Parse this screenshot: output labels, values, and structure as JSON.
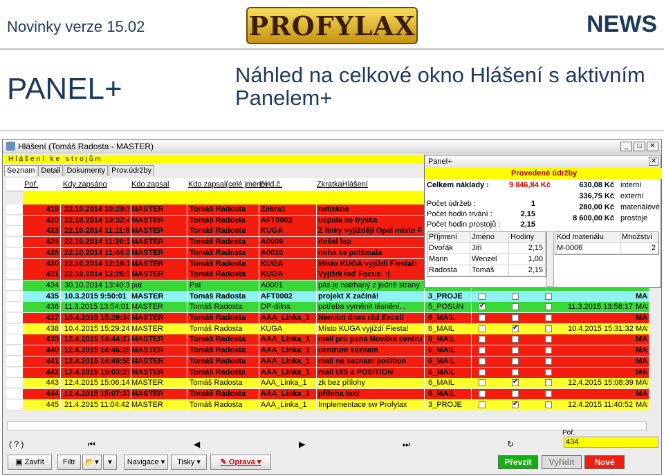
{
  "header": {
    "left": "Novinky verze 15.02",
    "logo": "PROFYLAX",
    "right": "NEWS"
  },
  "slide": {
    "title": "PANEL+",
    "subtitle": "Náhled na celkové okno Hlášení s aktivním Panelem+"
  },
  "window": {
    "title": "Hlášení (Tomáš Radosta - MASTER)",
    "subheader": "Hlášení ke strojům",
    "tabs": [
      "Seznam",
      "Detail",
      "Dokumenty",
      "Prov.údržby"
    ],
    "columns": [
      "Poř.",
      "Kdy zapsáno",
      "Kdo zapsal",
      "Kdo zapsal(celé jméno)",
      "Evid.č.",
      "ZkratkaHlášení"
    ],
    "rows": [
      {
        "n": "419",
        "d": "22.10.2014 10:29:3",
        "u": "MASTER",
        "f": "Tomáš Radosta",
        "e": "Zebra1",
        "z": "netiskne",
        "c3": "",
        "bg": "#f21c0f",
        "bold": true
      },
      {
        "n": "420",
        "d": "22.10.2014 10:32:4",
        "u": "MASTER",
        "f": "Tomáš Radosta",
        "e": "AFT0002",
        "z": "ucpala se tryska",
        "c3": "",
        "bg": "#f21c0f",
        "bold": true
      },
      {
        "n": "423",
        "d": "22.10.2014 11:11:5",
        "u": "MASTER",
        "f": "Tomáš Radosta",
        "e": "KUGA",
        "z": "Z linky vyjíždějí Opel místo F",
        "c3": "",
        "bg": "#f21c0f",
        "bold": true
      },
      {
        "n": "426",
        "d": "22.10.2014 11:20:1",
        "u": "MASTER",
        "f": "Tomáš Radosta",
        "e": "A0009",
        "z": "došel lep",
        "c3": "",
        "bg": "#f21c0f",
        "bold": true
      },
      {
        "n": "428",
        "d": "22.10.2014 11:44:2",
        "u": "MASTER",
        "f": "Tomáš Radosta",
        "e": "A0010",
        "z": "noha se polámala",
        "c3": "",
        "bg": "#f21c0f",
        "bold": true
      },
      {
        "n": "430",
        "d": "22.10.2014 12:16:1",
        "u": "MASTER",
        "f": "Tomáš Radosta",
        "e": "KUGA",
        "z": "Místo KUGA vyjíždí Fiesta!!",
        "c3": "",
        "bg": "#f21c0f",
        "bold": true
      },
      {
        "n": "431",
        "d": "22.10.2014 12:26:3",
        "u": "MASTER",
        "f": "Tomáš Radosta",
        "e": "KUGA",
        "z": "Vyjíždí teď Focus. :(",
        "c3": "",
        "bg": "#f21c0f",
        "bold": true
      },
      {
        "n": "434",
        "d": "30.10.2014 13:40:30",
        "u": "pat",
        "f": "Pat",
        "e": "A0001",
        "z": "pás je natrhaný z jedné strany",
        "c3": "",
        "bg": "#38d838",
        "bold": false
      },
      {
        "n": "435",
        "d": "10.3.2015 9:50:01",
        "u": "MASTER",
        "f": "Tomáš Radosta",
        "e": "AFT0002",
        "z": "projekt X začíná!",
        "c3": "3_PROJE",
        "bg": "#8ff2f2",
        "bold": true,
        "chk": [
          0,
          0,
          0
        ],
        "dt": ""
      },
      {
        "n": "436",
        "d": "11.3.2015 13:54:01",
        "u": "MASTER",
        "f": "Tomáš Radosta",
        "e": "DP-dílna",
        "z": "potřeba vyměnit těsnění...",
        "c3": "5_POSUN",
        "bg": "#38d838",
        "bold": false,
        "chk": [
          1,
          0,
          0
        ],
        "dt": "11.3.2015 13:58:17"
      },
      {
        "n": "437",
        "d": "10.4.2015 15:29:34",
        "u": "MASTER",
        "f": "Tomáš Radosta",
        "e": "AAA_Linka_1",
        "z": "Nemám dnes rád Excel!",
        "c3": "6_MAIL",
        "bg": "#f21c0f",
        "bold": true,
        "chk": [
          0,
          0,
          0
        ],
        "dt": ""
      },
      {
        "n": "438",
        "d": "10.4.2015 15:29:24",
        "u": "MASTER",
        "f": "Tomáš Radosta",
        "e": "KUGA",
        "z": "Místo KUGA vyjíždí Fiesta!",
        "c3": "6_MAIL",
        "bg": "#ffff2a",
        "bold": false,
        "chk": [
          0,
          1,
          0
        ],
        "dt": "10.4.2015 15:31:32"
      },
      {
        "n": "439",
        "d": "12.4.2015 14:44:27",
        "u": "MASTER",
        "f": "Tomáš Radosta",
        "e": "AAA_Linka_1",
        "z": "mail pro pana Nováka centrum",
        "c3": "6_MAIL",
        "bg": "#f21c0f",
        "bold": true,
        "chk": [
          0,
          0,
          0
        ],
        "dt": ""
      },
      {
        "n": "440",
        "d": "12.4.2015 14:46:28",
        "u": "MASTER",
        "f": "Tomáš Radosta",
        "e": "AAA_Linka_1",
        "z": "centrum seznam",
        "c3": "6_MAIL",
        "bg": "#f21c0f",
        "bold": true,
        "chk": [
          0,
          0,
          0
        ],
        "dt": ""
      },
      {
        "n": "441",
        "d": "12.4.2015 14:48:55",
        "u": "MASTER",
        "f": "Tomáš Radosta",
        "e": "AAA_Linka_1",
        "z": "mail na seznam position",
        "c3": "6_MAIL",
        "bg": "#f21c0f",
        "bold": true,
        "chk": [
          0,
          0,
          0
        ],
        "dt": ""
      },
      {
        "n": "442",
        "d": "12.4.2015 15:03:23",
        "u": "MASTER",
        "f": "Tomáš Radosta",
        "e": "AAA_Linka_1",
        "z": "mail UIS a POSITION",
        "c3": "6_MAIL",
        "bg": "#f21c0f",
        "bold": true,
        "chk": [
          0,
          0,
          0
        ],
        "dt": ""
      },
      {
        "n": "443",
        "d": "12.4.2015 15:06:14",
        "u": "MASTER",
        "f": "Tomáš Radosta",
        "e": "AAA_Linka_1",
        "z": "zk bez přílohy",
        "c3": "6_MAIL",
        "bg": "#ffff2a",
        "bold": false,
        "chk": [
          0,
          1,
          0
        ],
        "dt": "12.4.2015 15:08:39"
      },
      {
        "n": "444",
        "d": "12.4.2015 15:07:37",
        "u": "MASTER",
        "f": "Tomáš Radosta",
        "e": "AAA_Linka_1",
        "z": "příloha text",
        "c3": "6_MAIL",
        "bg": "#f21c0f",
        "bold": true,
        "chk": [
          0,
          0,
          0
        ],
        "dt": ""
      },
      {
        "n": "445",
        "d": "21.4.2015 11:04:42",
        "u": "MASTER",
        "f": "Tomáš Radosta",
        "e": "AAA_Linka_1",
        "z": "Implementace sw Profylax",
        "c3": "3_PROJE",
        "bg": "#ffff2a",
        "bold": false,
        "chk": [
          0,
          1,
          0
        ],
        "dt": "12.4.2015 11:40:52"
      }
    ],
    "extra_col": "MAS",
    "nav": {
      "help": "( ? )",
      "first": "⏮",
      "prev": "◀",
      "next": "▶",
      "last": "⏭",
      "refresh": "↻"
    },
    "por": {
      "label": "Poř.",
      "value": "434"
    },
    "toolbar": {
      "close": "Zavřít",
      "filter": "Filtr",
      "navigace": "Navigace",
      "tisky": "Tisky",
      "oprava": "Oprava",
      "prevzit": "Převzít",
      "vyridit": "Vyřídit",
      "nove": "Nové"
    }
  },
  "panel": {
    "title": "Panel+",
    "section": "Provedené údržby",
    "total_label": "Celkem náklady :",
    "total_value": "9 846,84 Kč",
    "costs": [
      {
        "v": "630,08 Kč",
        "l": "interní"
      },
      {
        "v": "336,75 Kč",
        "l": "externí"
      },
      {
        "v": "280,00 Kč",
        "l": "materiálové"
      },
      {
        "v": "8 600,00 Kč",
        "l": "prostoje"
      }
    ],
    "stats": [
      {
        "l": "Počet údržeb :",
        "v": "1"
      },
      {
        "l": "Počet hodin trvání :",
        "v": "2,15"
      },
      {
        "l": "Počet hodin prostojů :",
        "v": "2,15"
      }
    ],
    "grid_cols": [
      "Příjmení",
      "Jméno",
      "Hodiny"
    ],
    "grid_rows": [
      [
        "Dvořák",
        "Jiří",
        "2,15"
      ],
      [
        "Mann",
        "Wenzel",
        "1,00"
      ],
      [
        "Radosta",
        "Tomáš",
        "2,15"
      ]
    ],
    "grid2_cols": [
      "Kód materiálu",
      "Množství"
    ],
    "grid2_rows": [
      [
        "M-0006",
        "2"
      ]
    ]
  }
}
